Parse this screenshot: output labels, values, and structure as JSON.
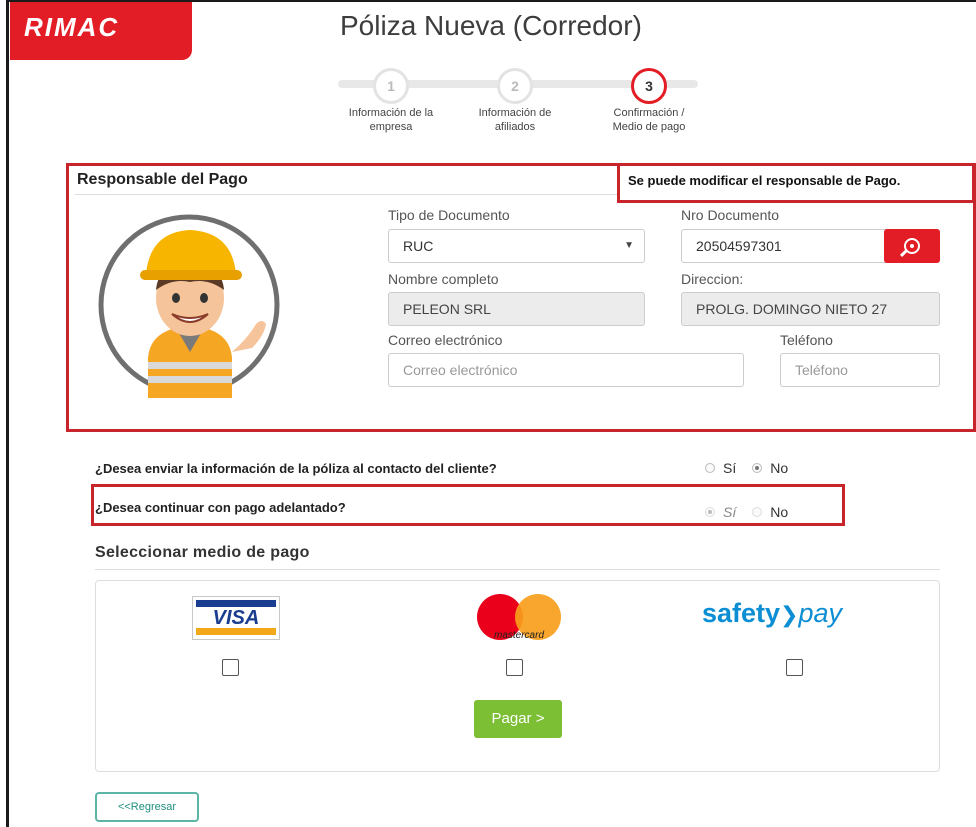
{
  "brand": {
    "logo_text": "RIMAC",
    "color": "#e31d25"
  },
  "page": {
    "title": "Póliza Nueva (Corredor)"
  },
  "stepper": {
    "steps": [
      {
        "number": "1",
        "label_line1": "Información de la",
        "label_line2": "empresa",
        "active": false
      },
      {
        "number": "2",
        "label_line1": "Información de",
        "label_line2": "afiliados",
        "active": false
      },
      {
        "number": "3",
        "label_line1": "Confirmación /",
        "label_line2": "Medio de pago",
        "active": true
      }
    ]
  },
  "responsable": {
    "title": "Responsable del Pago",
    "annotation": "Se puede modificar el responsable de Pago.",
    "tipo_documento": {
      "label": "Tipo de Documento",
      "value": "RUC"
    },
    "nro_documento": {
      "label": "Nro Documento",
      "value": "20504597301"
    },
    "nombre": {
      "label": "Nombre completo",
      "value": "PELEON SRL"
    },
    "direccion": {
      "label": "Direccion:",
      "value": "PROLG. DOMINGO NIETO 27"
    },
    "correo": {
      "label": "Correo electrónico",
      "placeholder": "Correo electrónico"
    },
    "telefono": {
      "label": "Teléfono",
      "placeholder": "Teléfono"
    }
  },
  "questions": {
    "enviar_info": {
      "text": "¿Desea enviar la información de la póliza al contacto del cliente?",
      "yes": "Sí",
      "no": "No",
      "selected": "No"
    },
    "pago_adelantado": {
      "text": "¿Desea continuar con pago adelantado?",
      "yes": "Sí",
      "no": "No",
      "selected": "Sí"
    }
  },
  "payment": {
    "title": "Seleccionar medio de pago",
    "methods": [
      {
        "name": "VISA",
        "icon": "visa-logo"
      },
      {
        "name": "mastercard",
        "icon": "mastercard-logo"
      },
      {
        "name_part1": "safety",
        "name_part2": "pay",
        "icon": "safetypay-logo"
      }
    ],
    "pay_button": "Pagar >",
    "back_button": "<<Regresar"
  }
}
